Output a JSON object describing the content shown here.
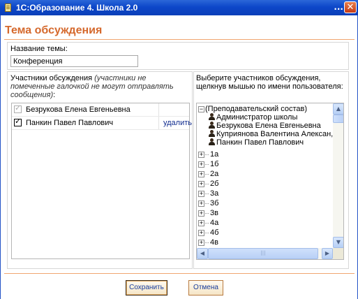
{
  "window": {
    "title": "1С:Образование 4. Школа 2.0",
    "title_overflow": "...",
    "close_glyph": "✕"
  },
  "heading": "Тема обсуждения",
  "topic": {
    "label": "Название темы:",
    "value": "Конференция"
  },
  "participants": {
    "caption_plain": "Участники обсуждения",
    "caption_italic": "(участники не помеченные галочкой не могут отправлять сообщения)",
    "caption_suffix": ":",
    "rows": [
      {
        "name": "Безрукова Елена Евгеньевна",
        "checked": true,
        "disabled": true,
        "action": ""
      },
      {
        "name": "Панкин Павел Павлович",
        "checked": true,
        "disabled": false,
        "action": "удалить"
      }
    ]
  },
  "selector": {
    "caption": "Выберите участников обсуждения, щелкнув мышью по имени пользователя:",
    "staff_group": "(Преподавательский состав)",
    "staff": [
      "Администратор школы",
      "Безрукова Елена Евгеньевна",
      "Куприянова Валентина Алексан,",
      "Панкин Павел Павлович"
    ],
    "classes": [
      "1а",
      "1б",
      "2а",
      "2б",
      "3а",
      "3б",
      "3в",
      "4а",
      "4б",
      "4в"
    ],
    "expand_glyph": "+",
    "collapse_glyph": "−",
    "person_icon": "person-icon"
  },
  "buttons": {
    "save": "Сохранить",
    "cancel": "Отмена"
  },
  "colors": {
    "accent": "#d5692d",
    "titlebar": "#0d47c9",
    "link": "#0f2b8f"
  }
}
